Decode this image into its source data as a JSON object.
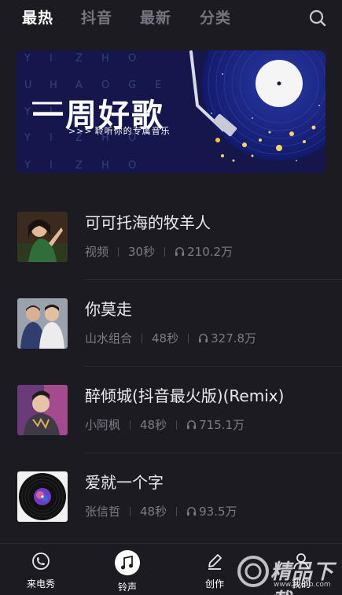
{
  "tabs": [
    {
      "label": "最热",
      "active": true
    },
    {
      "label": "抖音",
      "active": false
    },
    {
      "label": "最新",
      "active": false
    },
    {
      "label": "分类",
      "active": false
    }
  ],
  "search": {
    "icon": "search-icon"
  },
  "banner": {
    "title": "一周好歌",
    "subtitle_arrows": ">>>",
    "subtitle": "聆听你的专属音乐",
    "bg_letters": [
      "Y I Z H O",
      "U H A O G",
      "Y I Z H O U",
      "Y I Z H O"
    ],
    "colors": {
      "background": "#14164a",
      "accent": "#f5c54a"
    }
  },
  "songs": [
    {
      "title": "可可托海的牧羊人",
      "artist": "视频",
      "duration": "30秒",
      "plays": "210.2万"
    },
    {
      "title": "你莫走",
      "artist": "山水组合",
      "duration": "48秒",
      "plays": "327.8万"
    },
    {
      "title": "醉倾城(抖音最火版)(Remix)",
      "artist": "小阿枫",
      "duration": "48秒",
      "plays": "715.1万"
    },
    {
      "title": "爱就一个字",
      "artist": "张信哲",
      "duration": "48秒",
      "plays": "93.5万"
    }
  ],
  "bottom_nav": [
    {
      "label": "来电秀",
      "icon": "phone-show-icon",
      "active": false
    },
    {
      "label": "铃声",
      "icon": "music-note-icon",
      "active": true
    },
    {
      "label": "创作",
      "icon": "pencil-icon",
      "active": false
    },
    {
      "label": "我的",
      "icon": "person-icon",
      "active": false
    }
  ],
  "watermark": {
    "text": "精品下载",
    "url": "www.jxlqzb.com"
  }
}
